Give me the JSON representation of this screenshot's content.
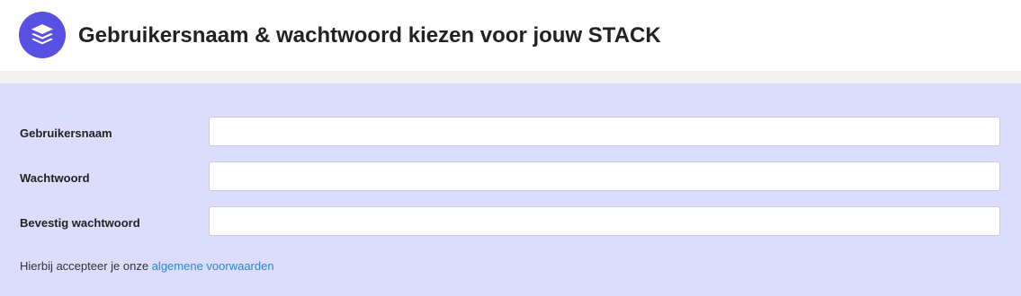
{
  "header": {
    "logo_icon": "stack-layers-icon",
    "title": "Gebruikersnaam & wachtwoord kiezen voor jouw STACK",
    "brand_color": "#5850e3"
  },
  "form": {
    "background_color": "#dcdcfd",
    "fields": [
      {
        "label": "Gebruikersnaam",
        "value": "",
        "type": "text"
      },
      {
        "label": "Wachtwoord",
        "value": "",
        "type": "password"
      },
      {
        "label": "Bevestig wachtwoord",
        "value": "",
        "type": "password"
      }
    ],
    "terms": {
      "text": "Hierbij accepteer je onze ",
      "link_text": "algemene voorwaarden",
      "link_color": "#2a87c9"
    }
  }
}
